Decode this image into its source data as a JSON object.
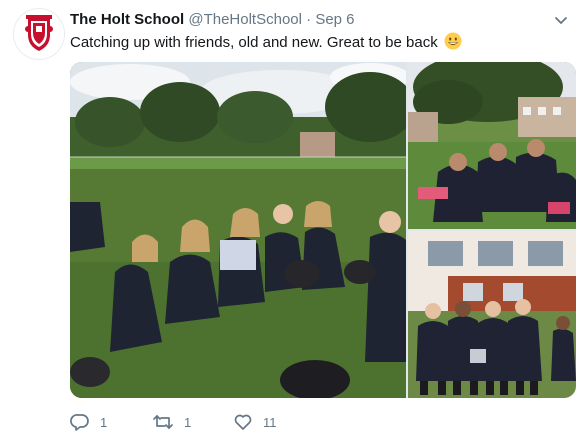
{
  "tweet": {
    "author_name": "The Holt School",
    "author_handle": "@TheHoltSchool",
    "separator": "·",
    "date": "Sep 6",
    "text": "Catching up with friends, old and new. Great to be back",
    "emoji": "grinning-face-emoji"
  },
  "media": {
    "photos": [
      "photo-group-on-grass",
      "photo-students-under-tree",
      "photo-students-by-building"
    ]
  },
  "actions": {
    "reply_count": "1",
    "retweet_count": "1",
    "like_count": "11"
  },
  "colors": {
    "text": "#14171a",
    "secondary": "#657786",
    "crest_red": "#c8102e",
    "grass": "#4f7a36",
    "sky": "#dfe6ec"
  }
}
